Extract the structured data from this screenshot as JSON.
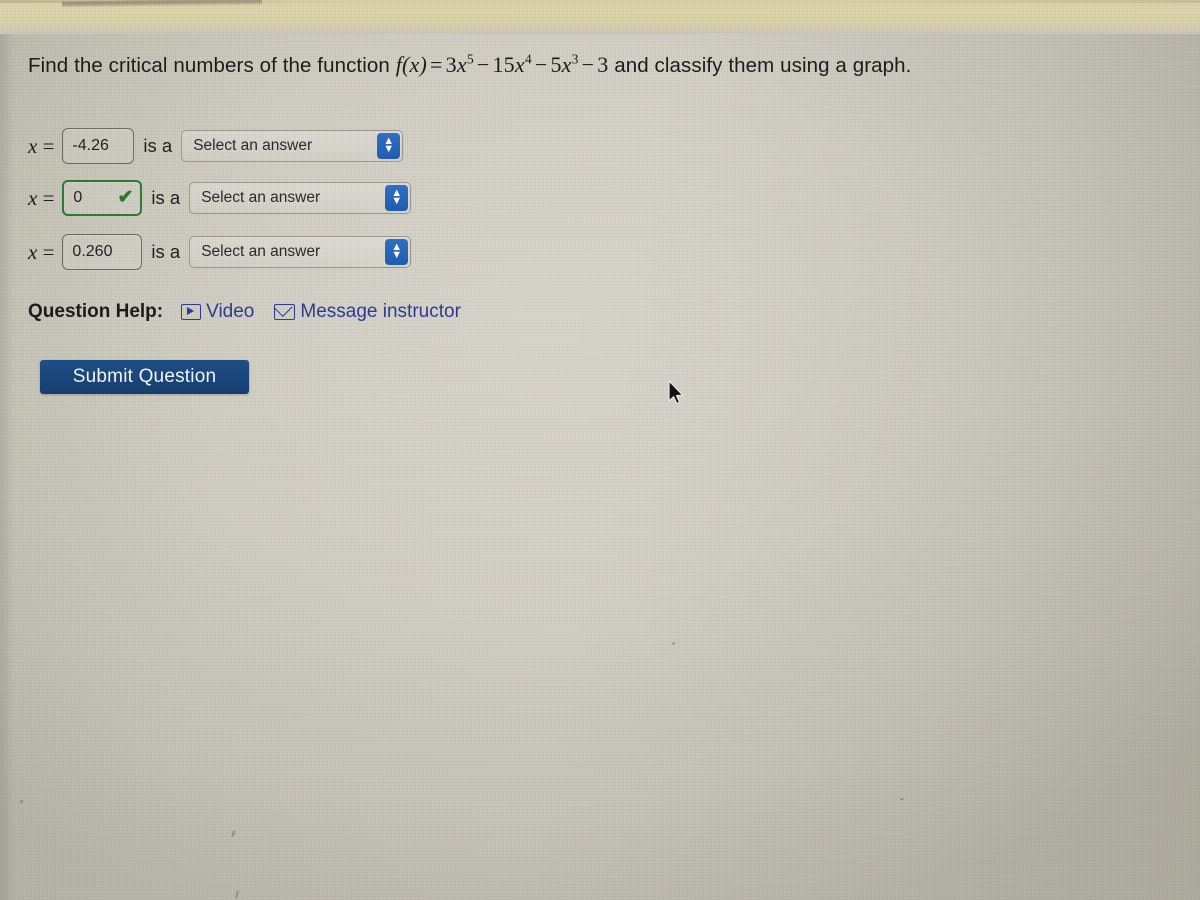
{
  "question": {
    "prefix": "Find the critical numbers of the function ",
    "math": {
      "fx": "f(x)",
      "equals": "=",
      "t1_coef": "3",
      "t1_var": "x",
      "t1_exp": "5",
      "op1": "−",
      "t2_coef": "15",
      "t2_var": "x",
      "t2_exp": "4",
      "op2": "−",
      "t3_coef": "5",
      "t3_var": "x",
      "t3_exp": "3",
      "op3": "−",
      "t4": "3"
    },
    "suffix": " and classify them using a graph.",
    "full_text": "Find the critical numbers of the function f(x) = 3x^5 - 15x^4 - 5x^3 - 3 and classify them using a graph."
  },
  "rows": [
    {
      "x_label": "x",
      "equals": "=",
      "value": "-4.26",
      "is_a": "is a",
      "select_value": "Select an answer",
      "status": "none",
      "check_glyph": ""
    },
    {
      "x_label": "x",
      "equals": "=",
      "value": "0",
      "is_a": "is a",
      "select_value": "Select an answer",
      "status": "correct",
      "check_glyph": "✔"
    },
    {
      "x_label": "x",
      "equals": "=",
      "value": "0.260",
      "is_a": "is a",
      "select_value": "Select an answer",
      "status": "none",
      "check_glyph": ""
    }
  ],
  "help": {
    "label": "Question Help:",
    "video_label": "Video",
    "video_icon": "video-play-icon",
    "message_label": "Message instructor",
    "message_icon": "envelope-icon"
  },
  "submit": {
    "label": "Submit Question"
  },
  "cursor": {
    "icon": "mouse-pointer-icon",
    "x": "668",
    "y": "380"
  },
  "colors": {
    "page_background": "#cdcabd",
    "top_band": "#ddd2a6",
    "link_blue": "#2f3b91",
    "submit_blue": "#1a4579",
    "correct_green": "#2f7a31",
    "select_arrow_blue": "#2f6fc4",
    "text_dark": "#1c1c1c"
  }
}
